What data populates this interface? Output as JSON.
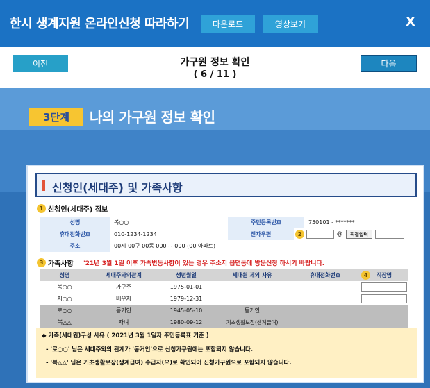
{
  "topbar": {
    "title": "한시 생계지원 온라인신청 따라하기",
    "download_label": "다운로드",
    "video_label": "영상보기",
    "close_label": "X"
  },
  "nav": {
    "prev_label": "이전",
    "next_label": "다음",
    "title": "가구원 정보 확인",
    "page": "( 6 / 11 )"
  },
  "step": {
    "badge": "3단계",
    "title": "나의 가구원 정보 확인"
  },
  "panel": {
    "title": "신청인(세대주) 및 가족사항",
    "section1": {
      "num": "1",
      "label": "신청인(세대주) 정보"
    },
    "applicant": {
      "name_label": "성명",
      "name_value": "복○○",
      "rrn_label": "주민등록번호",
      "rrn_value": "750101 - *******",
      "mobile_label": "휴대전화번호",
      "mobile_value": "010-1234-1234",
      "email_label": "전자우편",
      "email_num": "2",
      "at_sign": "@",
      "direct_input_label": "직접입력",
      "address_label": "주소",
      "address_value": "00시 00구 00동 000 ~ 000 (00 아파트)"
    },
    "section3": {
      "num": "3",
      "label": "가족사항",
      "note": "'21년 3월 1일 이후 가족변동사항이 있는 경우 주소지 읍면동에 방문신청 하시기 바랍니다."
    },
    "family": {
      "headers": [
        "성명",
        "세대주와의관계",
        "생년월일",
        "세대원 제외 사유",
        "휴대전화번호",
        "직장명"
      ],
      "job_num": "4",
      "rows": [
        {
          "name": "복○○",
          "relation": "가구주",
          "birth": "1975-01-01",
          "reason": "",
          "phone": "",
          "shaded": false
        },
        {
          "name": "지○○",
          "relation": "배우자",
          "birth": "1979-12-31",
          "reason": "",
          "phone": "",
          "shaded": false
        },
        {
          "name": "로○○",
          "relation": "동거인",
          "birth": "1945-05-10",
          "reason": "동거인",
          "phone": "",
          "shaded": true
        },
        {
          "name": "복△△",
          "relation": "자녀",
          "birth": "1980-09-12",
          "reason": "기초생활보장(생계급여)",
          "phone": "",
          "shaded": true
        }
      ]
    },
    "notes": {
      "heading": "◆ 가족(세대원)구성 사유 ( 2021년 3월 1일자 주민등록표 기준 )",
      "line1": "- '로○○' 님은 세대주와의 관계가 '동거인'으로 신청가구원에는 포함되지 않습니다.",
      "line2": "- '복△△' 님은 기초생활보장(생계급여) 수급자(으)로 확인되어 신청가구원으로 포함되지 않습니다."
    }
  },
  "colors": {
    "topbar": "#1b72c4",
    "stage": "#2f72b8",
    "badge": "#f7c531",
    "warning_text": "#d62020",
    "notes_bg": "#fff0c4"
  }
}
